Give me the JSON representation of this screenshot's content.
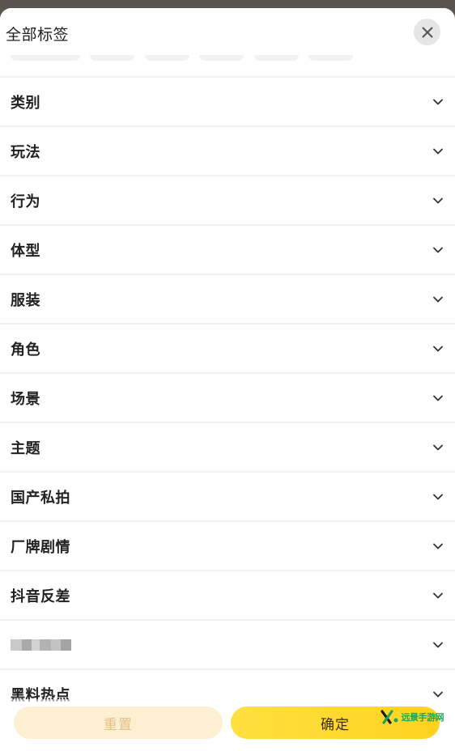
{
  "header": {
    "title": "全部标签"
  },
  "categories": [
    {
      "label": "类别"
    },
    {
      "label": "玩法"
    },
    {
      "label": "行为"
    },
    {
      "label": "体型"
    },
    {
      "label": "服装"
    },
    {
      "label": "角色"
    },
    {
      "label": "场景"
    },
    {
      "label": "主题"
    },
    {
      "label": "国产私拍"
    },
    {
      "label": "厂牌剧情"
    },
    {
      "label": "抖音反差"
    },
    {
      "label": ""
    },
    {
      "label": "黑料热点"
    }
  ],
  "footer": {
    "reset_label": "重置",
    "confirm_label": "确定",
    "watermark_text": "远景手游网"
  },
  "colors": {
    "accent": "#ffd21f",
    "reset_bg": "#fcefd2",
    "reset_text": "#e5c183"
  },
  "icons": {
    "close": "close-icon",
    "expand": "chevron-down-icon",
    "watermark": "logo-mark"
  }
}
